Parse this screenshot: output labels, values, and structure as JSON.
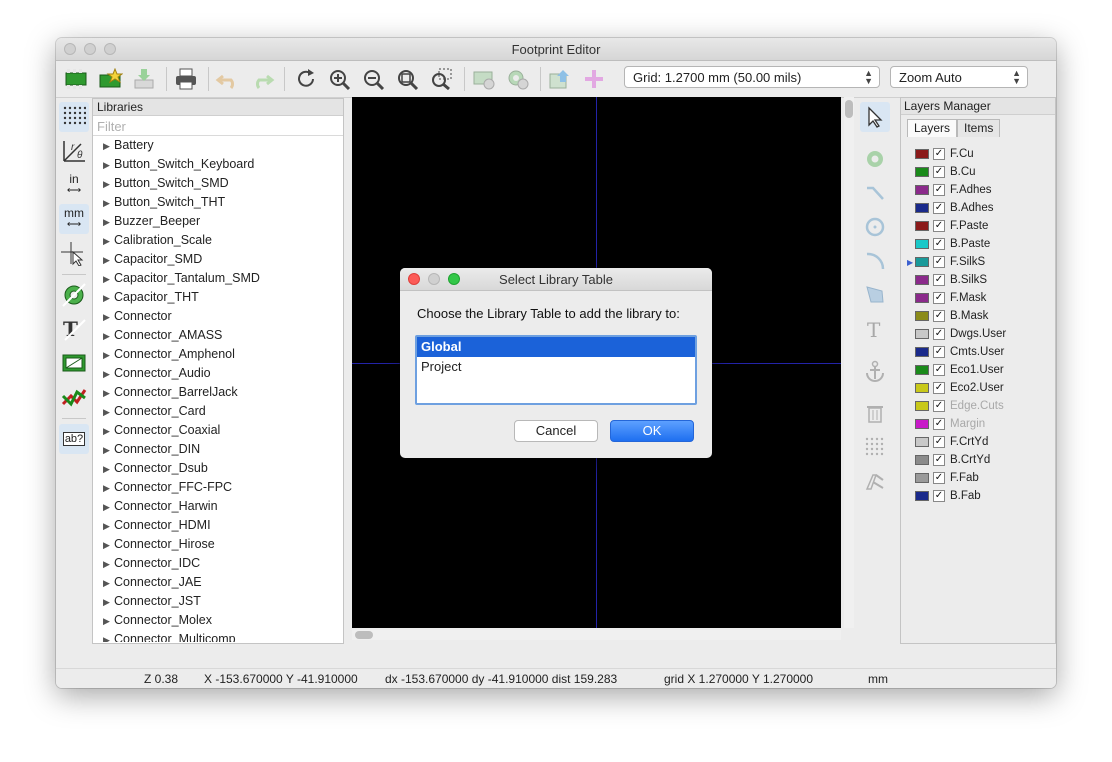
{
  "window": {
    "title": "Footprint Editor"
  },
  "toolbar": {
    "grid_select": "Grid: 1.2700 mm (50.00 mils)",
    "zoom_select": "Zoom Auto"
  },
  "left_tools": {
    "units_in": "in",
    "units_mm": "mm",
    "text_tool": "ab?"
  },
  "libraries": {
    "header": "Libraries",
    "filter_placeholder": "Filter",
    "items": [
      "Battery",
      "Button_Switch_Keyboard",
      "Button_Switch_SMD",
      "Button_Switch_THT",
      "Buzzer_Beeper",
      "Calibration_Scale",
      "Capacitor_SMD",
      "Capacitor_Tantalum_SMD",
      "Capacitor_THT",
      "Connector",
      "Connector_AMASS",
      "Connector_Amphenol",
      "Connector_Audio",
      "Connector_BarrelJack",
      "Connector_Card",
      "Connector_Coaxial",
      "Connector_DIN",
      "Connector_Dsub",
      "Connector_FFC-FPC",
      "Connector_Harwin",
      "Connector_HDMI",
      "Connector_Hirose",
      "Connector_IDC",
      "Connector_JAE",
      "Connector_JST",
      "Connector_Molex",
      "Connector_Multicomp"
    ]
  },
  "layers_manager": {
    "header": "Layers Manager",
    "tabs": [
      "Layers",
      "Items"
    ],
    "layers": [
      {
        "name": "F.Cu",
        "color": "#8b1a1a",
        "dim": false
      },
      {
        "name": "B.Cu",
        "color": "#1a8a1a",
        "dim": false
      },
      {
        "name": "F.Adhes",
        "color": "#8b2a8b",
        "dim": false
      },
      {
        "name": "B.Adhes",
        "color": "#1a2a8b",
        "dim": false
      },
      {
        "name": "F.Paste",
        "color": "#8b1a1a",
        "dim": false
      },
      {
        "name": "B.Paste",
        "color": "#1ac8c8",
        "dim": false
      },
      {
        "name": "F.SilkS",
        "color": "#1a9a9a",
        "dim": false
      },
      {
        "name": "B.SilkS",
        "color": "#8b2a8b",
        "dim": false
      },
      {
        "name": "F.Mask",
        "color": "#8b2a8b",
        "dim": false
      },
      {
        "name": "B.Mask",
        "color": "#8b8b1a",
        "dim": false
      },
      {
        "name": "Dwgs.User",
        "color": "#c8c8c8",
        "dim": false
      },
      {
        "name": "Cmts.User",
        "color": "#1a2a8b",
        "dim": false
      },
      {
        "name": "Eco1.User",
        "color": "#1a8a1a",
        "dim": false
      },
      {
        "name": "Eco2.User",
        "color": "#c8c81a",
        "dim": false
      },
      {
        "name": "Edge.Cuts",
        "color": "#c8c81a",
        "dim": true
      },
      {
        "name": "Margin",
        "color": "#c81ac8",
        "dim": true
      },
      {
        "name": "F.CrtYd",
        "color": "#c8c8c8",
        "dim": false
      },
      {
        "name": "B.CrtYd",
        "color": "#8b8b8b",
        "dim": false
      },
      {
        "name": "F.Fab",
        "color": "#9a9a9a",
        "dim": false
      },
      {
        "name": "B.Fab",
        "color": "#1a2a8b",
        "dim": false
      }
    ],
    "active_layer": "F.SilkS"
  },
  "status_bar": {
    "zoom": "Z 0.38",
    "xy": "X -153.670000  Y -41.910000",
    "delta": "dx -153.670000  dy -41.910000  dist 159.283",
    "grid": "grid X 1.270000  Y 1.270000",
    "units": "mm"
  },
  "dialog": {
    "title": "Select Library Table",
    "prompt": "Choose the Library Table to add the library to:",
    "options": [
      "Global",
      "Project"
    ],
    "selected": "Global",
    "cancel_label": "Cancel",
    "ok_label": "OK"
  }
}
